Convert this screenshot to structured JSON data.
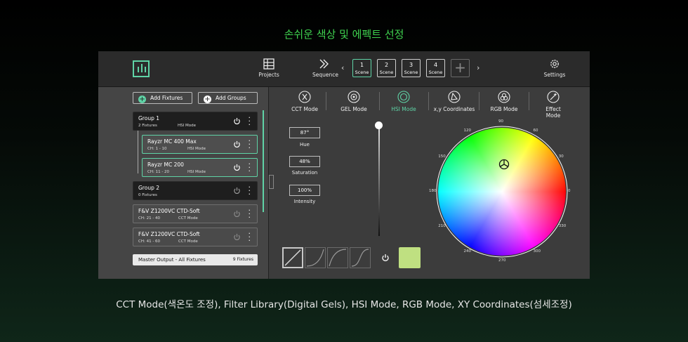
{
  "headline": "손쉬운 색상 및 에펙트 선정",
  "caption": "CCT Mode(색온도 조정), Filter Library(Digital Gels), HSI Mode, RGB Mode, XY Coordinates(섬세조정)",
  "topbar": {
    "projects_label": "Projects",
    "sequence_label": "Sequence",
    "settings_label": "Settings",
    "scenes": [
      {
        "num": "1",
        "label": "Scene"
      },
      {
        "num": "2",
        "label": "Scene"
      },
      {
        "num": "3",
        "label": "Scene"
      },
      {
        "num": "4",
        "label": "Scene"
      }
    ],
    "active_scene": "1",
    "add_scene_glyph": "+",
    "prev_glyph": "‹",
    "next_glyph": "›"
  },
  "left": {
    "add_fixtures": "Add Fixtures",
    "add_groups": "Add Groups",
    "add_glyph": "+",
    "cards": [
      {
        "name": "Group 1",
        "sub": "2 Fixtures",
        "mode": "HSI Mode"
      },
      {
        "name": "Rayzr MC 400 Max",
        "sub": "CH: 1 - 10",
        "mode": "HSI Mode"
      },
      {
        "name": "Rayzr MC 200",
        "sub": "CH: 11 - 20",
        "mode": "HSI Mode"
      },
      {
        "name": "Group 2",
        "sub": "0 Fixtures",
        "mode": ""
      },
      {
        "name": "F&V Z1200VC CTD-Soft",
        "sub": "CH: 21 - 40",
        "mode": "CCT Mode"
      },
      {
        "name": "F&V Z1200VC CTD-Soft",
        "sub": "CH: 41 - 60",
        "mode": "CCT Mode"
      }
    ],
    "master_label": "Master Output - All Fixtures",
    "master_count": "9 Fixtures"
  },
  "modes": {
    "items": [
      "CCT Mode",
      "GEL Mode",
      "HSI Mode",
      "x,y Coordinates",
      "RGB Mode",
      "Effect Mode"
    ],
    "active": "HSI Mode"
  },
  "hsi": {
    "hue_value": "87°",
    "hue_label": "Hue",
    "saturation_value": "48%",
    "saturation_label": "Saturation",
    "intensity_value": "100%",
    "intensity_label": "Intensity",
    "intensity_slider_fraction": 1.0,
    "swatch_color": "#bfe081",
    "wheel_labels": [
      "90",
      "60",
      "30",
      "0",
      "330",
      "300",
      "270",
      "240",
      "210",
      "180",
      "150",
      "120"
    ]
  },
  "colors": {
    "accent": "#5fd3a6",
    "headline": "#3fd14f"
  }
}
